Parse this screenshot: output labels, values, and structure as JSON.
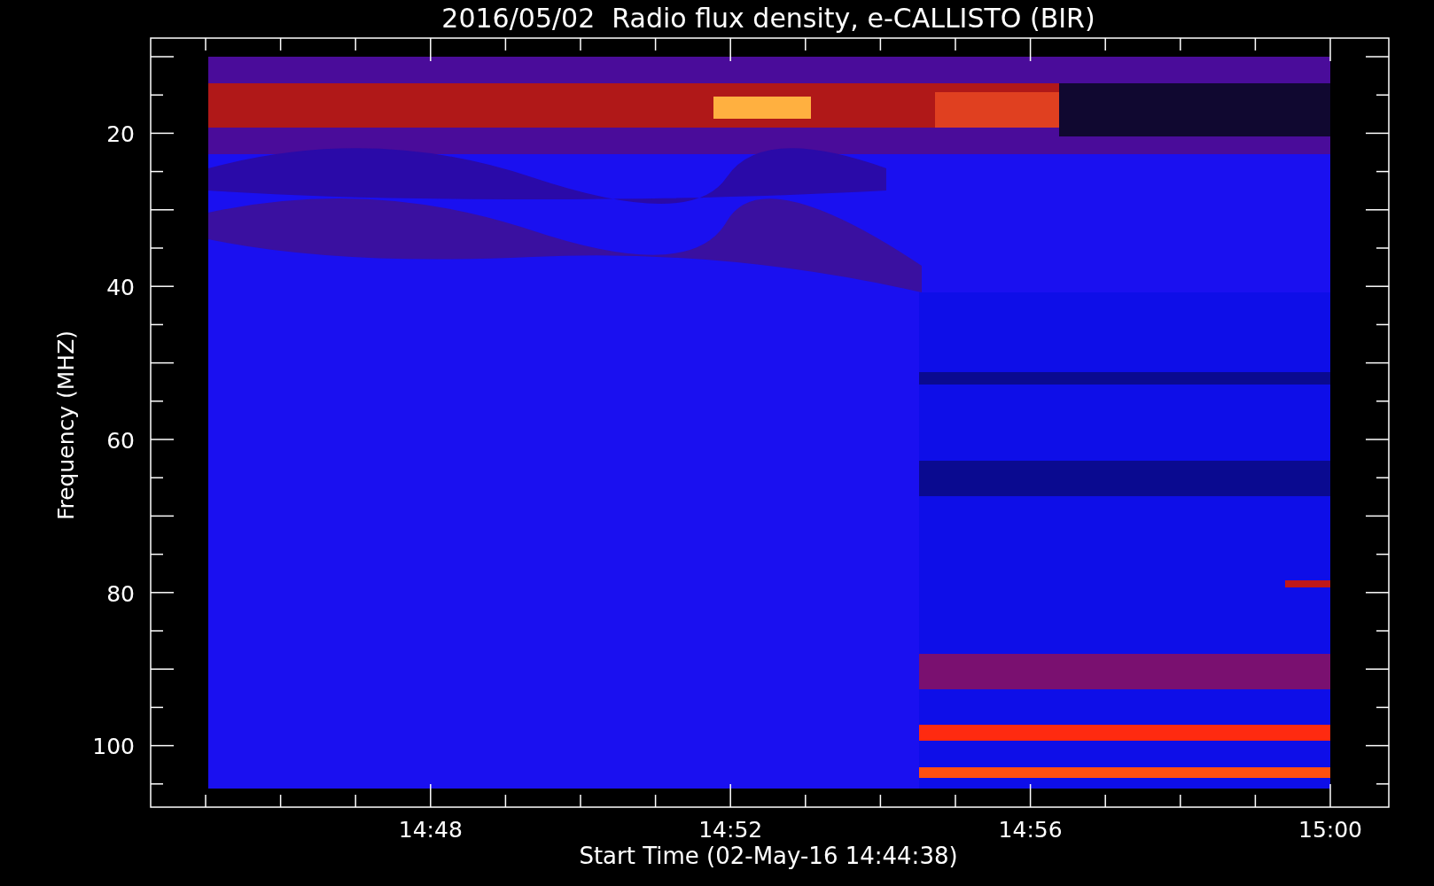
{
  "title": "2016/05/02  Radio flux density, e-CALLISTO (BIR)",
  "y_axis": {
    "label": "Frequency (MHZ)",
    "ticks": [
      "20",
      "40",
      "60",
      "80",
      "100"
    ]
  },
  "x_axis": {
    "label": "Start Time (02-May-16 14:44:38)",
    "ticks": [
      "14:48",
      "14:52",
      "14:56",
      "15:00"
    ]
  }
}
